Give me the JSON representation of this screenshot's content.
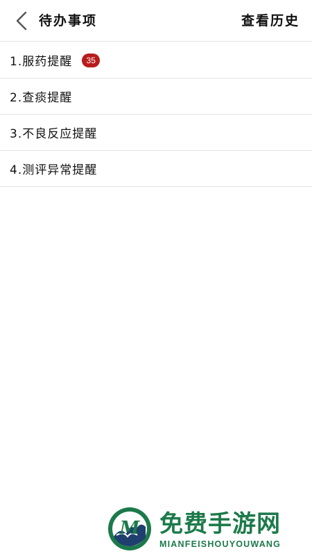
{
  "header": {
    "title": "待办事项",
    "history_label": "查看历史"
  },
  "items": [
    {
      "label": "1.服药提醒",
      "badge": "35"
    },
    {
      "label": "2.查痰提醒"
    },
    {
      "label": "3.不良反应提醒"
    },
    {
      "label": "4.测评异常提醒"
    }
  ],
  "watermark": {
    "title": "免费手游网",
    "subtitle": "MIANFEISHOUYOUWANG"
  },
  "colors": {
    "badge": "#b81c1c",
    "divider": "#e3e3e3",
    "watermark": "#1c7a4a"
  },
  "icons": {
    "back": "chevron-left-icon",
    "watermark_logo": "m-wave-logo-icon"
  }
}
